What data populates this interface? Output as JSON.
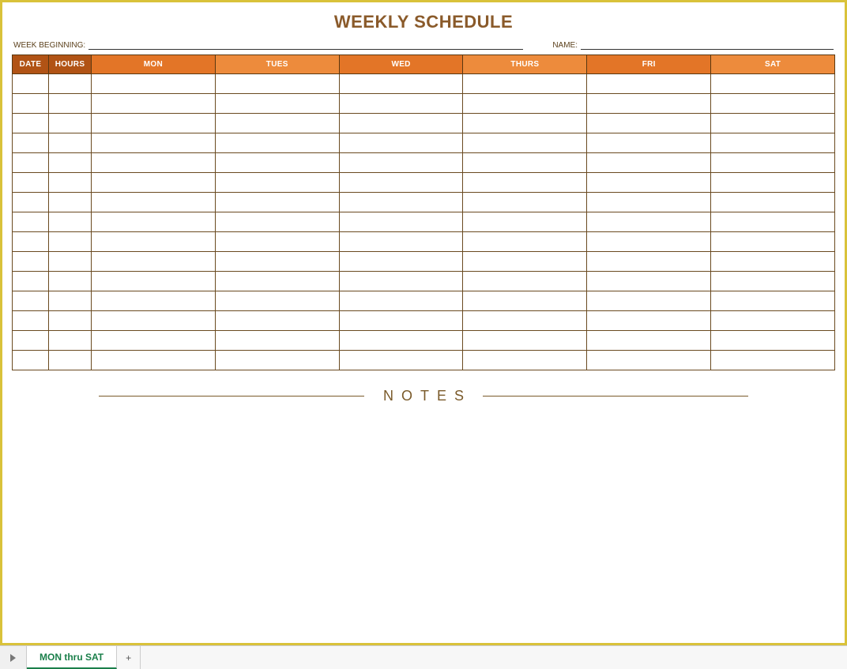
{
  "title": "WEEKLY SCHEDULE",
  "meta": {
    "week_label": "WEEK BEGINNING:",
    "week_value": "",
    "name_label": "NAME:",
    "name_value": ""
  },
  "columns": {
    "date": {
      "label": "DATE",
      "shade": "dark"
    },
    "hours": {
      "label": "HOURS",
      "shade": "dark"
    },
    "mon": {
      "label": "MON",
      "shade": "mid"
    },
    "tues": {
      "label": "TUES",
      "shade": "light"
    },
    "wed": {
      "label": "WED",
      "shade": "mid"
    },
    "thurs": {
      "label": "THURS",
      "shade": "light"
    },
    "fri": {
      "label": "FRI",
      "shade": "mid"
    },
    "sat": {
      "label": "SAT",
      "shade": "light"
    }
  },
  "rows": [
    {
      "date": "",
      "hours": "",
      "mon": "",
      "tues": "",
      "wed": "",
      "thurs": "",
      "fri": "",
      "sat": ""
    },
    {
      "date": "",
      "hours": "",
      "mon": "",
      "tues": "",
      "wed": "",
      "thurs": "",
      "fri": "",
      "sat": ""
    },
    {
      "date": "",
      "hours": "",
      "mon": "",
      "tues": "",
      "wed": "",
      "thurs": "",
      "fri": "",
      "sat": ""
    },
    {
      "date": "",
      "hours": "",
      "mon": "",
      "tues": "",
      "wed": "",
      "thurs": "",
      "fri": "",
      "sat": ""
    },
    {
      "date": "",
      "hours": "",
      "mon": "",
      "tues": "",
      "wed": "",
      "thurs": "",
      "fri": "",
      "sat": ""
    },
    {
      "date": "",
      "hours": "",
      "mon": "",
      "tues": "",
      "wed": "",
      "thurs": "",
      "fri": "",
      "sat": ""
    },
    {
      "date": "",
      "hours": "",
      "mon": "",
      "tues": "",
      "wed": "",
      "thurs": "",
      "fri": "",
      "sat": ""
    },
    {
      "date": "",
      "hours": "",
      "mon": "",
      "tues": "",
      "wed": "",
      "thurs": "",
      "fri": "",
      "sat": ""
    },
    {
      "date": "",
      "hours": "",
      "mon": "",
      "tues": "",
      "wed": "",
      "thurs": "",
      "fri": "",
      "sat": ""
    },
    {
      "date": "",
      "hours": "",
      "mon": "",
      "tues": "",
      "wed": "",
      "thurs": "",
      "fri": "",
      "sat": ""
    },
    {
      "date": "",
      "hours": "",
      "mon": "",
      "tues": "",
      "wed": "",
      "thurs": "",
      "fri": "",
      "sat": ""
    },
    {
      "date": "",
      "hours": "",
      "mon": "",
      "tues": "",
      "wed": "",
      "thurs": "",
      "fri": "",
      "sat": ""
    },
    {
      "date": "",
      "hours": "",
      "mon": "",
      "tues": "",
      "wed": "",
      "thurs": "",
      "fri": "",
      "sat": ""
    },
    {
      "date": "",
      "hours": "",
      "mon": "",
      "tues": "",
      "wed": "",
      "thurs": "",
      "fri": "",
      "sat": ""
    },
    {
      "date": "",
      "hours": "",
      "mon": "",
      "tues": "",
      "wed": "",
      "thurs": "",
      "fri": "",
      "sat": ""
    }
  ],
  "notes": {
    "label": "NOTES",
    "content": ""
  },
  "tabs": {
    "active": "MON thru SAT",
    "add_symbol": "+"
  },
  "colors": {
    "frame": "#d9c23a",
    "header_dark": "#b15315",
    "header_mid": "#e37527",
    "header_light": "#ed8b3c",
    "text_accent": "#7a5a2a"
  }
}
